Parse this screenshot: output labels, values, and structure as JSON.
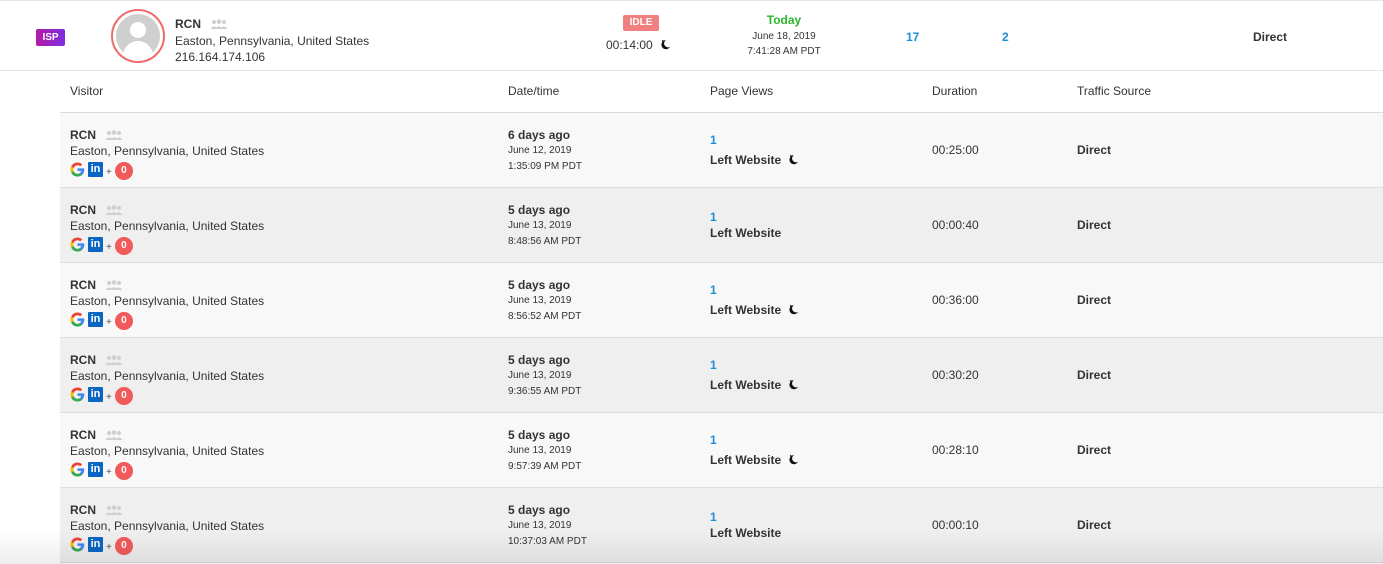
{
  "summary": {
    "isp_badge": "ISP",
    "name": "RCN",
    "location": "Easton, Pennsylvania, United States",
    "ip": "216.164.174.106",
    "status_badge": "IDLE",
    "idle_time": "00:14:00",
    "day": "Today",
    "date": "June 18, 2019",
    "time": "7:41:28 AM PDT",
    "visits": "17",
    "pages": "2",
    "source": "Direct",
    "colors": {
      "isp": "#9b27c8",
      "idle": "#f08080",
      "today": "#2bb52b",
      "link": "#1a8fd6",
      "avatar_ring": "#f06a6a"
    }
  },
  "table": {
    "headers": {
      "visitor": "Visitor",
      "datetime": "Date/time",
      "page_views": "Page Views",
      "duration": "Duration",
      "traffic_source": "Traffic Source"
    },
    "rows": [
      {
        "name": "RCN",
        "location": "Easton, Pennsylvania, United States",
        "plus": "+",
        "count": "0",
        "ago": "6 days ago",
        "date": "June 12, 2019",
        "time": "1:35:09 PM PDT",
        "views": "1",
        "status": "Left Website",
        "status_icon": "moon-icon",
        "duration": "00:25:00",
        "source": "Direct"
      },
      {
        "name": "RCN",
        "location": "Easton, Pennsylvania, United States",
        "plus": "+",
        "count": "0",
        "ago": "5 days ago",
        "date": "June 13, 2019",
        "time": "8:48:56 AM PDT",
        "views": "1",
        "status": "Left Website",
        "status_icon": "",
        "duration": "00:00:40",
        "source": "Direct"
      },
      {
        "name": "RCN",
        "location": "Easton, Pennsylvania, United States",
        "plus": "+",
        "count": "0",
        "ago": "5 days ago",
        "date": "June 13, 2019",
        "time": "8:56:52 AM PDT",
        "views": "1",
        "status": "Left Website",
        "status_icon": "moon-icon",
        "duration": "00:36:00",
        "source": "Direct"
      },
      {
        "name": "RCN",
        "location": "Easton, Pennsylvania, United States",
        "plus": "+",
        "count": "0",
        "ago": "5 days ago",
        "date": "June 13, 2019",
        "time": "9:36:55 AM PDT",
        "views": "1",
        "status": "Left Website",
        "status_icon": "moon-icon",
        "duration": "00:30:20",
        "source": "Direct"
      },
      {
        "name": "RCN",
        "location": "Easton, Pennsylvania, United States",
        "plus": "+",
        "count": "0",
        "ago": "5 days ago",
        "date": "June 13, 2019",
        "time": "9:57:39 AM PDT",
        "views": "1",
        "status": "Left Website",
        "status_icon": "moon-icon",
        "duration": "00:28:10",
        "source": "Direct"
      },
      {
        "name": "RCN",
        "location": "Easton, Pennsylvania, United States",
        "plus": "+",
        "count": "0",
        "ago": "5 days ago",
        "date": "June 13, 2019",
        "time": "10:37:03 AM PDT",
        "views": "1",
        "status": "Left Website",
        "status_icon": "",
        "duration": "00:00:10",
        "source": "Direct"
      }
    ]
  }
}
